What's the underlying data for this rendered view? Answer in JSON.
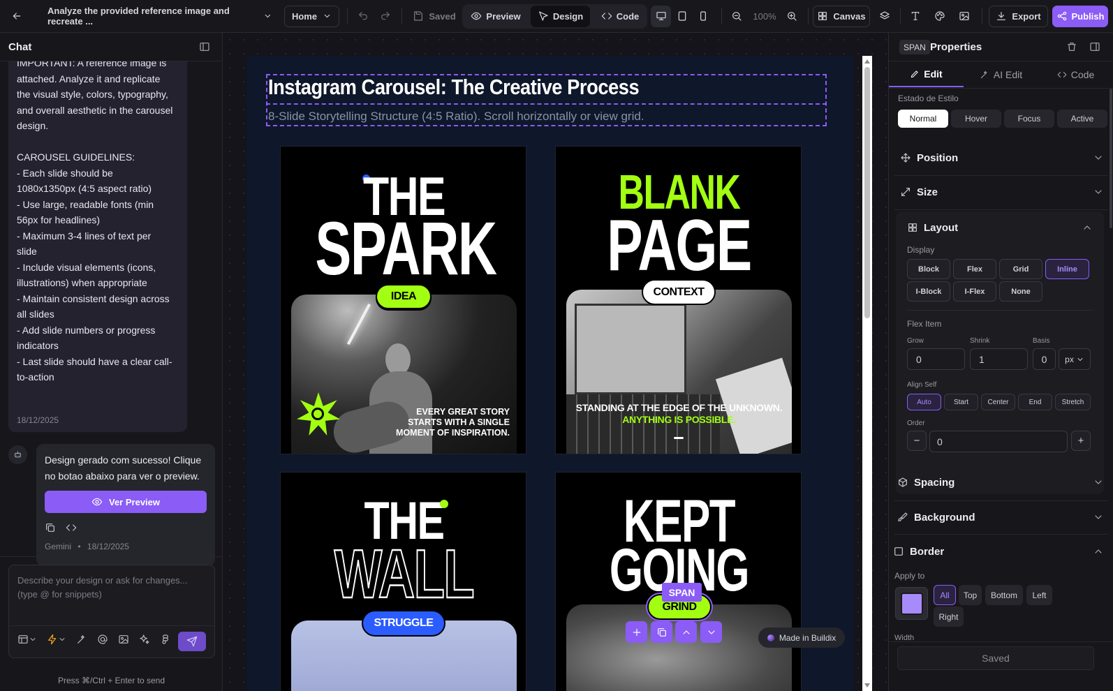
{
  "topbar": {
    "project_title": "Analyze the provided reference image and recreate ...",
    "page_select": "Home",
    "saved": "Saved",
    "preview": "Preview",
    "design": "Design",
    "code": "Code",
    "zoom": "100%",
    "canvas": "Canvas",
    "export": "Export",
    "publish": "Publish"
  },
  "chat": {
    "title": "Chat",
    "user_message_lines": [
      "IMPORTANT: A reference image is",
      "attached. Analyze it and replicate",
      "the visual style, colors, typography,",
      "and overall aesthetic in the carousel",
      "design.",
      "",
      "CAROUSEL GUIDELINES:",
      "- Each slide should be",
      "1080x1350px (4:5 aspect ratio)",
      "- Use large, readable fonts (min",
      "56px for headlines)",
      "- Maximum 3-4 lines of text per",
      "slide",
      "- Include visual elements (icons,",
      "illustrations) when appropriate",
      "- Maintain consistent design across",
      "all slides",
      "- Add slide numbers or progress",
      "indicators",
      "- Last slide should have a clear call-",
      "to-action"
    ],
    "user_date": "18/12/2025",
    "ai_message": "Design gerado com sucesso! Clique no botao abaixo para ver o preview.",
    "ver_preview": "Ver Preview",
    "ai_author": "Gemini",
    "ai_dot": "•",
    "ai_date": "18/12/2025",
    "input_placeholder": "Describe your design or ask for changes... (type @ for snippets)",
    "hint": "Press ⌘/Ctrl + Enter to send"
  },
  "canvas": {
    "title": "Instagram Carousel: The Creative Process",
    "subtitle": "8-Slide Storytelling Structure (4:5 Ratio). Scroll horizontally or view grid.",
    "slides": [
      {
        "line1": "THE",
        "line2": "SPARK",
        "tag": "IDEA",
        "caption": "EVERY GREAT STORY STARTS WITH A SINGLE MOMENT OF INSPIRATION."
      },
      {
        "line1": "BLANK",
        "line2": "PAGE",
        "tag": "CONTEXT",
        "caption1": "STANDING AT THE EDGE OF THE UNKNOWN.",
        "caption2": "ANYTHING IS POSSIBLE."
      },
      {
        "line1": "THE",
        "line2": "WALL",
        "tag": "STRUGGLE"
      },
      {
        "line1": "KEPT",
        "line2": "GOING",
        "tag": "GRIND"
      }
    ],
    "span_badge": "SPAN",
    "made_in": "Made in Buildix"
  },
  "props": {
    "el_tag": "SPAN",
    "title": "Properties",
    "tabs": [
      "Edit",
      "AI Edit",
      "Code"
    ],
    "style_state_label": "Estado de Estilo",
    "style_states": [
      "Normal",
      "Hover",
      "Focus",
      "Active"
    ],
    "position": "Position",
    "size": "Size",
    "layout": "Layout",
    "display_label": "Display",
    "display_opts": [
      "Block",
      "Flex",
      "Grid",
      "Inline",
      "I-Block",
      "I-Flex",
      "None"
    ],
    "flex_item": "Flex Item",
    "grow_label": "Grow",
    "shrink_label": "Shrink",
    "basis_label": "Basis",
    "grow": "0",
    "shrink": "1",
    "basis": "0",
    "basis_unit": "px",
    "align_self_label": "Align Self",
    "align_opts": [
      "Auto",
      "Start",
      "Center",
      "End",
      "Stretch"
    ],
    "order_label": "Order",
    "order": "0",
    "spacing": "Spacing",
    "background": "Background",
    "border": "Border",
    "apply_to": "Apply to",
    "apply_opts": [
      "All",
      "Top",
      "Bottom",
      "Left",
      "Right"
    ],
    "width_label": "Width",
    "footer": "Saved"
  },
  "colors": {
    "accent": "#8b5cf6",
    "lime": "#a3ff12",
    "blue": "#2a5cff"
  }
}
